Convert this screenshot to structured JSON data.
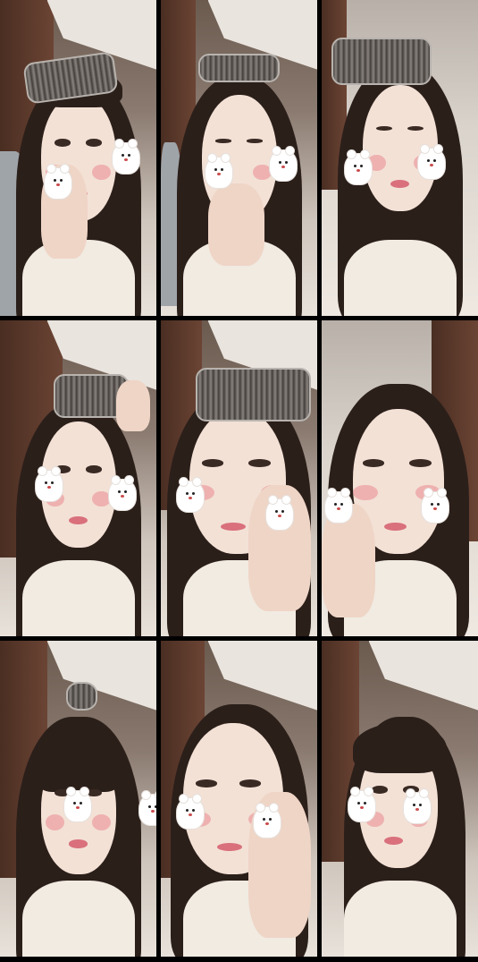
{
  "collage": {
    "layout": "3x3 grid",
    "divider_color": "#000000",
    "panels": [
      {
        "scene": "applying-product-with-roller",
        "has_roller": true,
        "has_hand": true
      },
      {
        "scene": "eyes-closed-with-roller",
        "has_roller": true,
        "has_hand": true
      },
      {
        "scene": "looking-down-with-roller",
        "has_roller": true,
        "has_hand": false
      },
      {
        "scene": "curling-lashes-with-roller",
        "has_roller": true,
        "has_hand": true
      },
      {
        "scene": "eyelash-curler-close-up",
        "has_roller": true,
        "has_hand": true
      },
      {
        "scene": "looking-sideways-no-roller",
        "has_roller": false,
        "has_hand": true
      },
      {
        "scene": "bangs-with-small-roller",
        "has_roller": true,
        "has_hand": false
      },
      {
        "scene": "applying-lashes-close-up",
        "has_roller": false,
        "has_hand": true
      },
      {
        "scene": "final-look-side-pose",
        "has_roller": false,
        "has_hand": false
      }
    ]
  },
  "colors": {
    "hair": "#2b1f1a",
    "skin": "#f3e1d6",
    "blush": "#e87882",
    "lips": "#d9707c",
    "door": "#4a2e22",
    "shirt": "#f1ebe2"
  },
  "icons": [
    "bear-sticker-icon"
  ]
}
